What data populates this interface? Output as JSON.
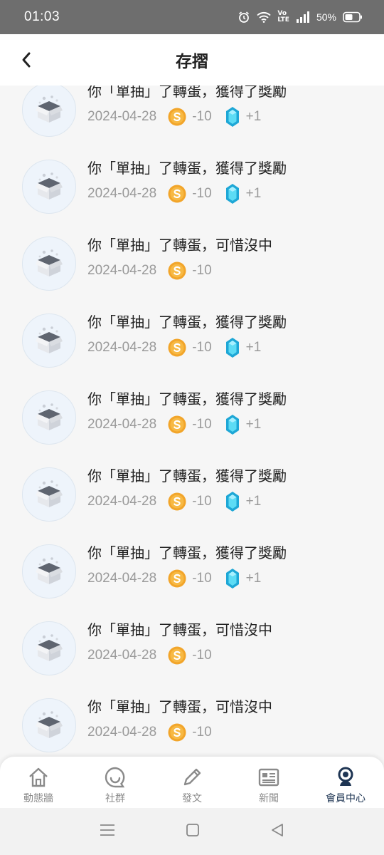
{
  "status": {
    "time": "01:03",
    "network_label_top": "Vo",
    "network_label_bottom": "LTE",
    "battery": "50%"
  },
  "header": {
    "title": "存摺"
  },
  "records": [
    {
      "text": "你「單抽」了轉蛋，獲得了獎勵",
      "date": "2024-04-28",
      "coin": "-10",
      "gem": "+1"
    },
    {
      "text": "你「單抽」了轉蛋，獲得了獎勵",
      "date": "2024-04-28",
      "coin": "-10",
      "gem": "+1"
    },
    {
      "text": "你「單抽」了轉蛋，可惜沒中",
      "date": "2024-04-28",
      "coin": "-10",
      "gem": null
    },
    {
      "text": "你「單抽」了轉蛋，獲得了獎勵",
      "date": "2024-04-28",
      "coin": "-10",
      "gem": "+1"
    },
    {
      "text": "你「單抽」了轉蛋，獲得了獎勵",
      "date": "2024-04-28",
      "coin": "-10",
      "gem": "+1"
    },
    {
      "text": "你「單抽」了轉蛋，獲得了獎勵",
      "date": "2024-04-28",
      "coin": "-10",
      "gem": "+1"
    },
    {
      "text": "你「單抽」了轉蛋，獲得了獎勵",
      "date": "2024-04-28",
      "coin": "-10",
      "gem": "+1"
    },
    {
      "text": "你「單抽」了轉蛋，可惜沒中",
      "date": "2024-04-28",
      "coin": "-10",
      "gem": null
    },
    {
      "text": "你「單抽」了轉蛋，可惜沒中",
      "date": "2024-04-28",
      "coin": "-10",
      "gem": null
    }
  ],
  "bottom_nav": [
    {
      "label": "動態牆",
      "icon": "home-icon",
      "active": false
    },
    {
      "label": "社群",
      "icon": "chat-bubble-icon",
      "active": false
    },
    {
      "label": "發文",
      "icon": "pencil-icon",
      "active": false
    },
    {
      "label": "新聞",
      "icon": "newspaper-icon",
      "active": false
    },
    {
      "label": "會員中心",
      "icon": "member-icon",
      "active": true
    }
  ],
  "colors": {
    "accent": "#1e3553",
    "coin": "#f2a52a",
    "gem": "#35c6e8",
    "muted_text": "#9a9a9a"
  }
}
